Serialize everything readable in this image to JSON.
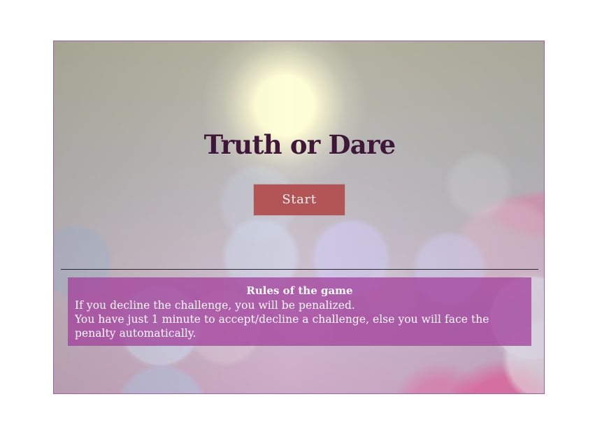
{
  "game": {
    "title": "Truth or Dare",
    "start_label": "Start",
    "rules": {
      "heading": "Rules of the game",
      "lines": [
        "If you decline the challenge, you will be penalized.",
        "You have just 1 minute to accept/decline a challenge, else you will face the penalty automatically."
      ]
    }
  },
  "colors": {
    "title": "#3e1739",
    "start_button": "#b35457",
    "rules_panel": "#a3419c",
    "border": "#9d62a8"
  }
}
